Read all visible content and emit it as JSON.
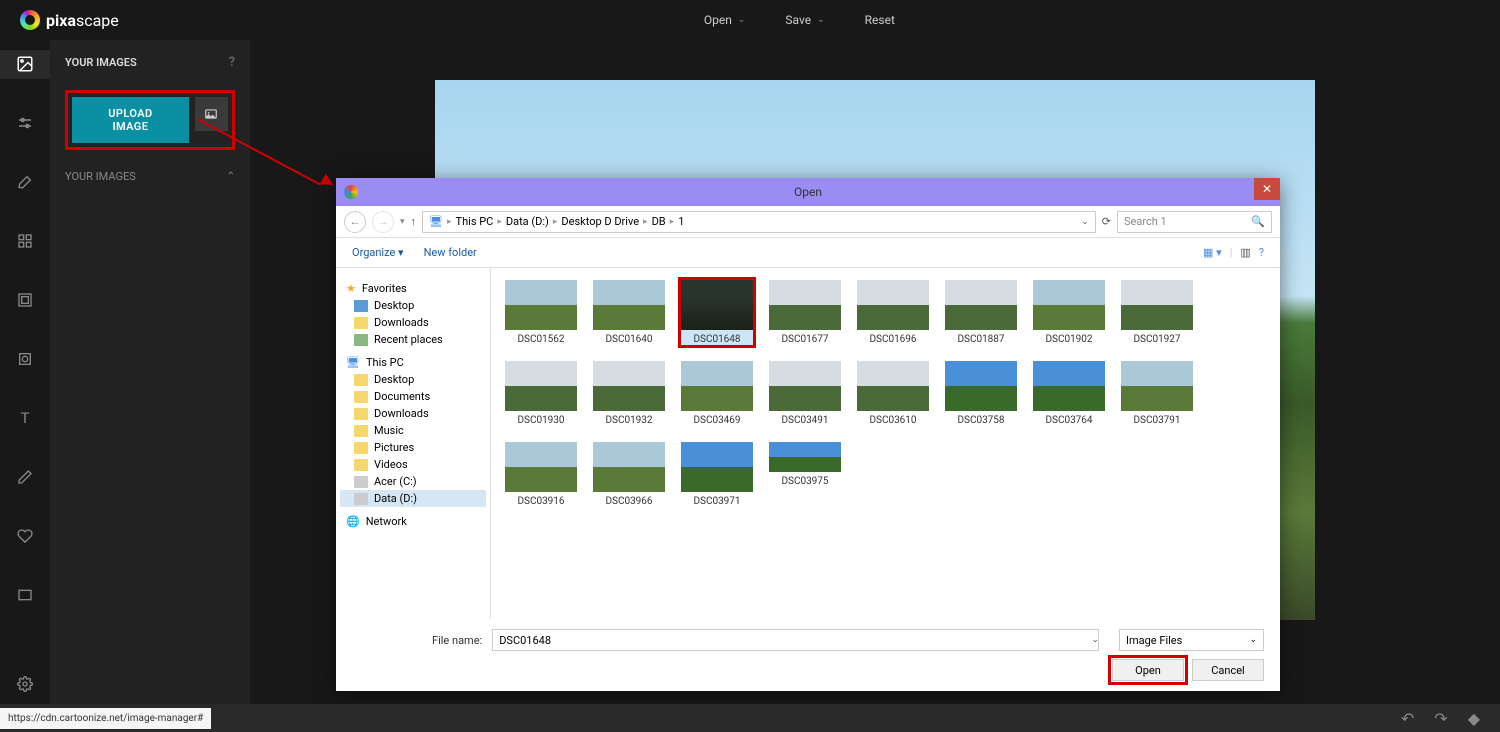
{
  "brand": {
    "name_prefix": "pixa",
    "name_suffix": "scape"
  },
  "header": {
    "open": "Open",
    "save": "Save",
    "reset": "Reset"
  },
  "sidebar": {
    "title": "YOUR IMAGES",
    "upload_label": "UPLOAD IMAGE",
    "section2": "YOUR IMAGES"
  },
  "dialog": {
    "title": "Open",
    "breadcrumb": [
      "This PC",
      "Data (D:)",
      "Desktop D Drive",
      "DB",
      "1"
    ],
    "search_placeholder": "Search 1",
    "organize": "Organize",
    "new_folder": "New folder",
    "tree": {
      "favorites": "Favorites",
      "fav_items": [
        "Desktop",
        "Downloads",
        "Recent places"
      ],
      "this_pc": "This PC",
      "pc_items": [
        "Desktop",
        "Documents",
        "Downloads",
        "Music",
        "Pictures",
        "Videos",
        "Acer (C:)",
        "Data (D:)"
      ],
      "network": "Network"
    },
    "thumbs": [
      {
        "name": "DSC01562",
        "cls": "sky-green"
      },
      {
        "name": "DSC01640",
        "cls": "sky-green"
      },
      {
        "name": "DSC01648",
        "cls": "dark-forest",
        "selected": true
      },
      {
        "name": "DSC01677",
        "cls": "foggy-green"
      },
      {
        "name": "DSC01696",
        "cls": "foggy-green"
      },
      {
        "name": "DSC01887",
        "cls": "foggy-green"
      },
      {
        "name": "DSC01902",
        "cls": "sky-green"
      },
      {
        "name": "DSC01927",
        "cls": "foggy-green"
      },
      {
        "name": "DSC01930",
        "cls": "foggy-green"
      },
      {
        "name": "DSC01932",
        "cls": "foggy-green"
      },
      {
        "name": "DSC03469",
        "cls": "sky-green"
      },
      {
        "name": "DSC03491",
        "cls": "foggy-green"
      },
      {
        "name": "DSC03610",
        "cls": "foggy-green"
      },
      {
        "name": "DSC03758",
        "cls": "blue-sky"
      },
      {
        "name": "DSC03764",
        "cls": "blue-sky"
      },
      {
        "name": "DSC03791",
        "cls": "sky-green"
      },
      {
        "name": "DSC03916",
        "cls": "sky-green"
      },
      {
        "name": "DSC03966",
        "cls": "sky-green"
      },
      {
        "name": "DSC03971",
        "cls": "blue-sky"
      },
      {
        "name": "DSC03975",
        "cls": "blue-sky",
        "pano": true
      }
    ],
    "filename_label": "File name:",
    "filename_value": "DSC01648",
    "filter": "Image Files",
    "open_btn": "Open",
    "cancel_btn": "Cancel"
  },
  "footer": {
    "url": "https://cdn.cartoonize.net/image-manager#"
  }
}
